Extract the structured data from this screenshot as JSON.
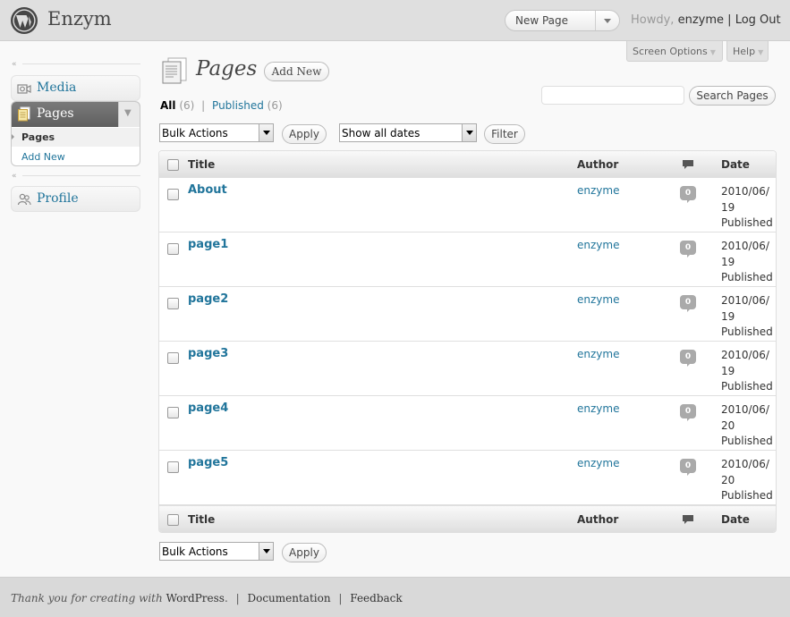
{
  "header": {
    "site_title": "Enzym",
    "favorite_actions": {
      "selected": "New Page"
    },
    "howdy_prefix": "Howdy,",
    "username": "enzyme",
    "separator": "|",
    "logout": "Log Out"
  },
  "screen_meta": {
    "screen_options": "Screen Options",
    "help": "Help"
  },
  "menu": {
    "media": "Media",
    "pages": "Pages",
    "pages_submenu": [
      "Pages",
      "Add New"
    ],
    "profile": "Profile"
  },
  "content": {
    "heading": "Pages",
    "add_new": "Add New",
    "filters": {
      "all_label": "All",
      "all_count": "(6)",
      "separator": "|",
      "published_label": "Published",
      "published_count": "(6)"
    },
    "search_button": "Search Pages",
    "search_value": "",
    "bulk_actions": "Bulk Actions",
    "apply": "Apply",
    "date_filter": "Show all dates",
    "filter_button": "Filter",
    "columns": {
      "title": "Title",
      "author": "Author",
      "comments_icon": "comment-bubble-icon",
      "date": "Date"
    },
    "rows": [
      {
        "title": "About",
        "author": "enzyme",
        "comments": "0",
        "date_line1": "2010/06/",
        "date_line2": "19",
        "status": "Published"
      },
      {
        "title": "page1",
        "author": "enzyme",
        "comments": "0",
        "date_line1": "2010/06/",
        "date_line2": "19",
        "status": "Published"
      },
      {
        "title": "page2",
        "author": "enzyme",
        "comments": "0",
        "date_line1": "2010/06/",
        "date_line2": "19",
        "status": "Published"
      },
      {
        "title": "page3",
        "author": "enzyme",
        "comments": "0",
        "date_line1": "2010/06/",
        "date_line2": "19",
        "status": "Published"
      },
      {
        "title": "page4",
        "author": "enzyme",
        "comments": "0",
        "date_line1": "2010/06/",
        "date_line2": "20",
        "status": "Published"
      },
      {
        "title": "page5",
        "author": "enzyme",
        "comments": "0",
        "date_line1": "2010/06/",
        "date_line2": "20",
        "status": "Published"
      }
    ]
  },
  "footer": {
    "thanks": "Thank you for creating with",
    "wordpress": "WordPress",
    "period": ".",
    "separator": "|",
    "documentation": "Documentation",
    "feedback": "Feedback"
  },
  "colors": {
    "link": "#21759b",
    "header_bg": "#dfdfdf",
    "menu_current": "#6d6d6d",
    "bubble": "#aaaaaa"
  }
}
